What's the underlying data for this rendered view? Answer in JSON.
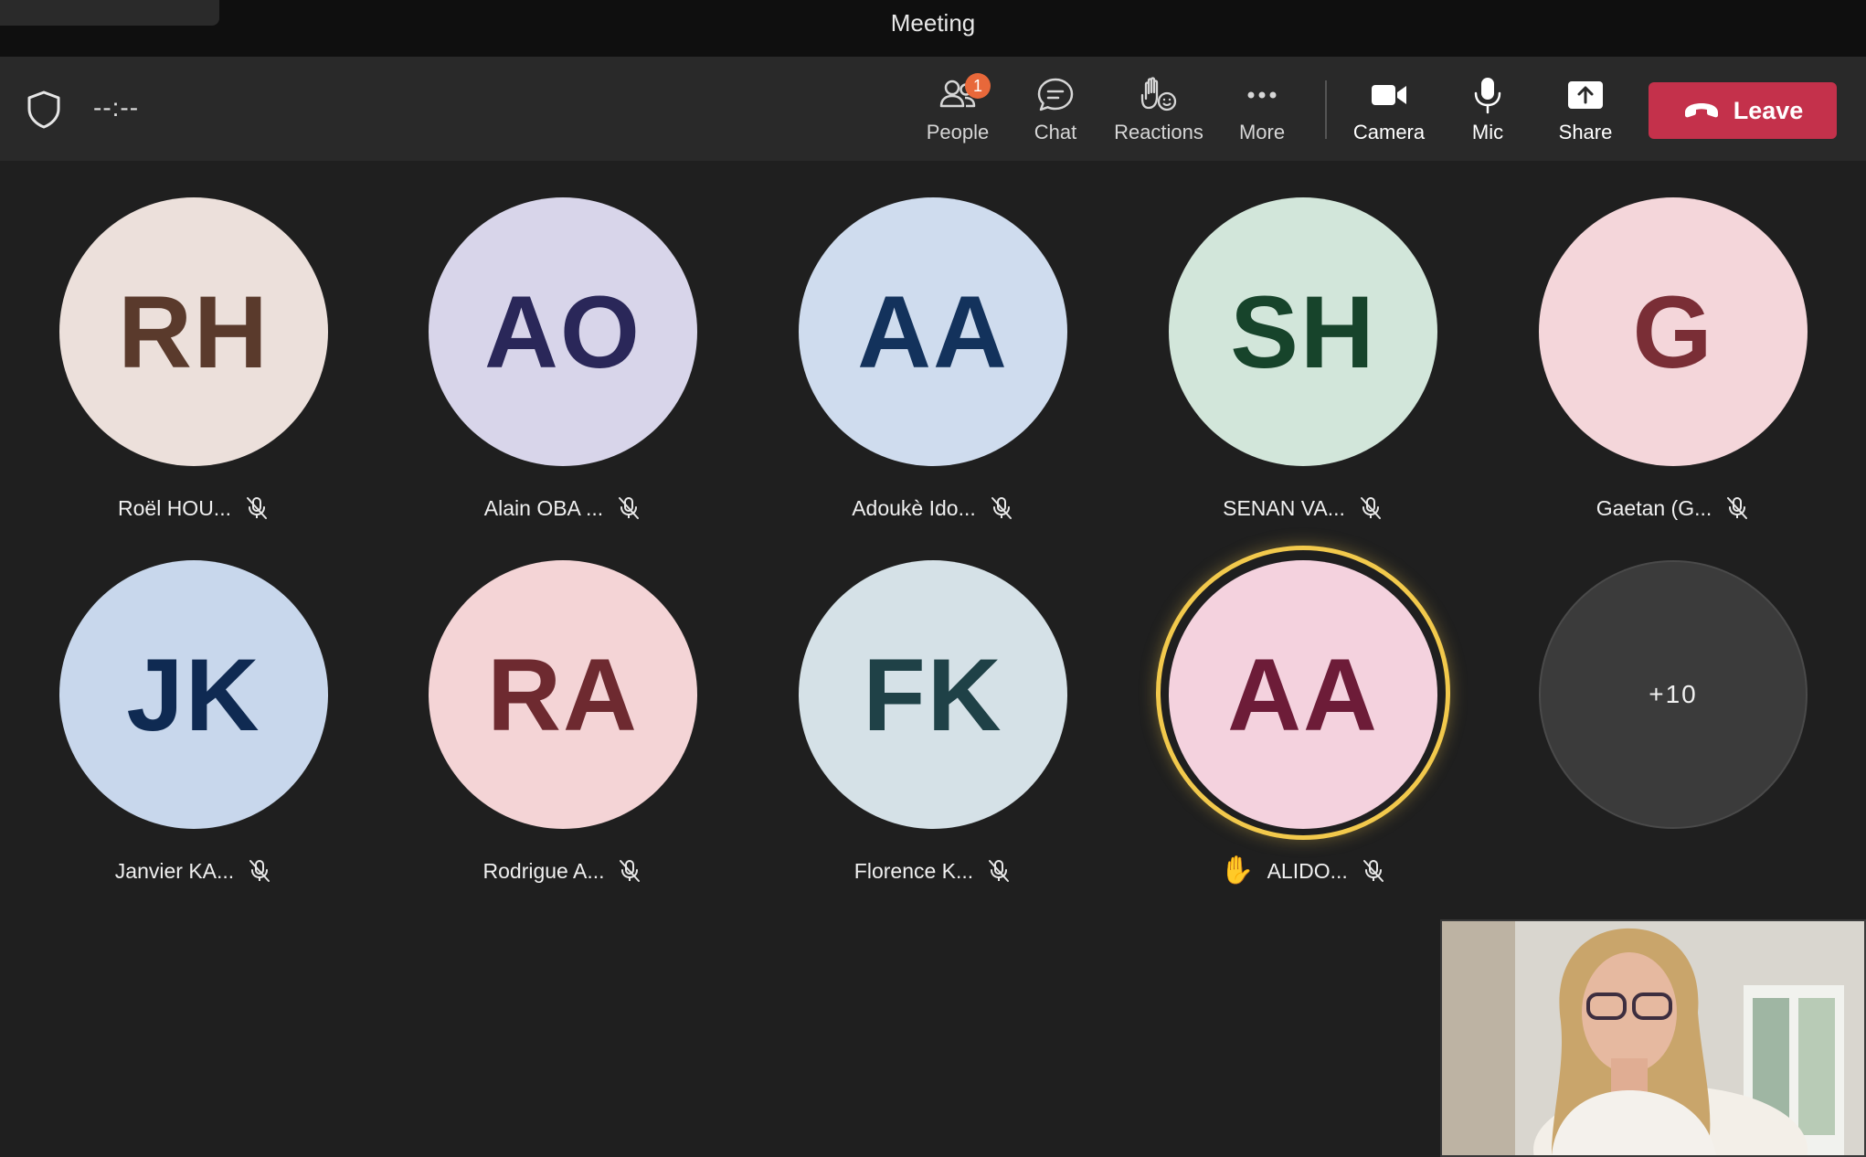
{
  "window": {
    "title": "Meeting"
  },
  "toolbar": {
    "timer": "--:--",
    "buttons": {
      "people": {
        "label": "People",
        "badge": "1",
        "icon": "people-icon"
      },
      "chat": {
        "label": "Chat",
        "icon": "chat-icon"
      },
      "reactions": {
        "label": "Reactions",
        "icon": "reactions-icon"
      },
      "more": {
        "label": "More",
        "icon": "more-icon"
      },
      "camera": {
        "label": "Camera",
        "icon": "camera-icon"
      },
      "mic": {
        "label": "Mic",
        "icon": "mic-icon"
      },
      "share": {
        "label": "Share",
        "icon": "share-icon"
      }
    },
    "leave": {
      "label": "Leave",
      "icon": "hangup-icon",
      "color": "#c4314b"
    }
  },
  "participants": [
    {
      "initials": "RH",
      "name": "Roël HOU...",
      "bg": "#ece0db",
      "fg": "#5a3a2c",
      "muted": true
    },
    {
      "initials": "AO",
      "name": "Alain OBA ...",
      "bg": "#d8d5ea",
      "fg": "#2a2759",
      "muted": true
    },
    {
      "initials": "AA",
      "name": "Adoukè Ido...",
      "bg": "#cfdcee",
      "fg": "#13325c",
      "muted": true
    },
    {
      "initials": "SH",
      "name": "SENAN VA...",
      "bg": "#d2e6da",
      "fg": "#17442b",
      "muted": true
    },
    {
      "initials": "G",
      "name": "Gaetan (G...",
      "bg": "#f4d6da",
      "fg": "#7a2e36",
      "muted": true
    },
    {
      "initials": "JK",
      "name": "Janvier KA...",
      "bg": "#c8d7ec",
      "fg": "#0f2a52",
      "muted": true
    },
    {
      "initials": "RA",
      "name": "Rodrigue A...",
      "bg": "#f4d4d6",
      "fg": "#6e2a30",
      "muted": true
    },
    {
      "initials": "FK",
      "name": "Florence K...",
      "bg": "#d5e1e7",
      "fg": "#1f4147",
      "muted": true
    },
    {
      "initials": "AA",
      "name": "ALIDO...",
      "bg": "#f4d2de",
      "fg": "#6d1c38",
      "muted": true,
      "hand_raised": true,
      "speaking": true
    },
    {
      "overflow": "+10"
    }
  ],
  "self_view": {
    "label": ""
  }
}
